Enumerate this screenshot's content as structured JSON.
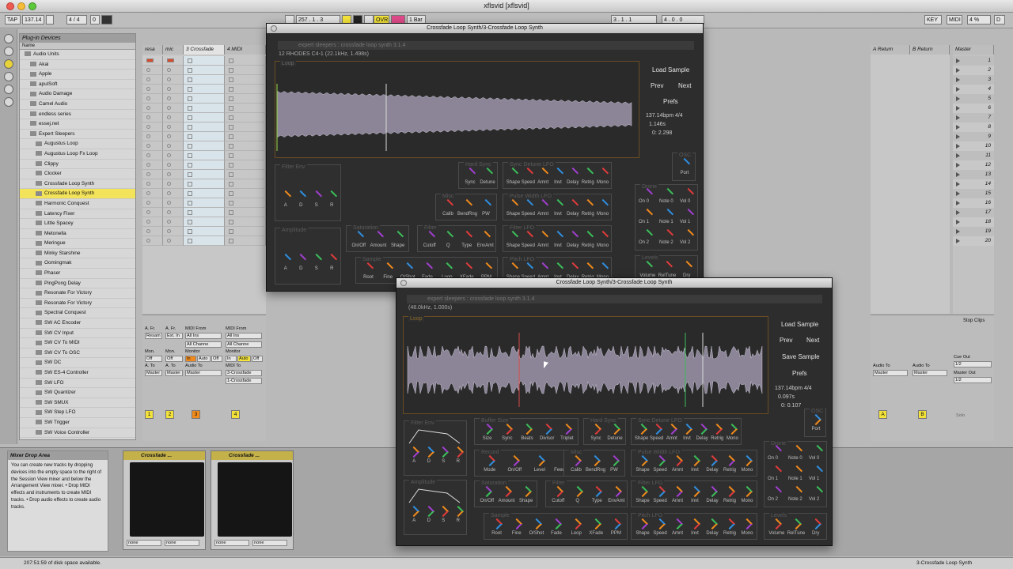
{
  "window": {
    "title": "xflsvid  [xflsvid]"
  },
  "toolbar": {
    "tap": "TAP",
    "tempo": "137.14",
    "sig": "4 / 4",
    "zero": "0",
    "position": "257 . 1 . 3",
    "ovr": "OVR",
    "quant": "1 Bar",
    "loop_start": "3 . 1 . 1",
    "loop_len": "4 . 0 . 0",
    "key": "KEY",
    "midi": "MIDI",
    "cpu": "4 %",
    "d": "D"
  },
  "browser": {
    "header": "Plug-in Devices",
    "column": "Name",
    "items": [
      "Audio Units",
      "Akai",
      "Apple",
      "apulSoft",
      "Audio Damage",
      "Camel Audio",
      "endless series",
      "essej.net",
      "Expert Sleepers",
      "Augustus Loop",
      "Augustus Loop Fx Loop",
      "Clippy",
      "Clocker",
      "Crossfade Loop Synth",
      "Crossfade Loop Synth",
      "Harmonic Conquest",
      "Latency Fixer",
      "Little Spacey",
      "Metonella",
      "Meringue",
      "Minky Starshine",
      "Oomingmak",
      "Phaser",
      "PingPong Delay",
      "Resonate For Victory",
      "Resonate For Victory",
      "Spectral Conquest",
      "SW AC Encoder",
      "SW CV Input",
      "SW CV To MIDI",
      "SW CV To OSC",
      "SW DC",
      "SW ES-4 Controller",
      "SW LFO",
      "SW Quantizer",
      "SW SMUX",
      "SW Step LFO",
      "SW Trigger",
      "SW Voice Controller"
    ]
  },
  "tracks": {
    "t1": "resa",
    "t2": "mic",
    "t3": "3 Crossfade",
    "t4": "4 MIDI",
    "a_return": "A Return",
    "b_return": "B Return",
    "master": "Master"
  },
  "scenes": [
    "1",
    "2",
    "3",
    "4",
    "5",
    "6",
    "7",
    "8",
    "9",
    "10",
    "11",
    "12",
    "13",
    "14",
    "15",
    "16",
    "17",
    "18",
    "19",
    "20"
  ],
  "mixer": {
    "afr": "A. Fr.",
    "resam": "Resam",
    "ext_in": "Ext. In",
    "midi_from": "MIDI From",
    "all_ins": "All Ins",
    "all_channels": "All Channe",
    "mon": "Mon.",
    "monitor": "Monitor",
    "in": "In",
    "auto": "Auto",
    "off": "Off",
    "ato": "A. To",
    "master": "Master",
    "audio_to": "Audio To",
    "midi_to": "MIDI To",
    "dest_synth": "3-Crossfade",
    "dest_synth2": "1-Crossfade",
    "n1": "1",
    "n2": "2",
    "n3": "3",
    "n4": "4",
    "cue_out": "Cue Out",
    "cue_val": "1/2",
    "master_out": "Master Out",
    "master_val": "1/2",
    "stop_clips": "Stop Clips",
    "a": "A",
    "b": "B",
    "solo": "Solo"
  },
  "info_view": {
    "title": "Mixer Drop Area",
    "text": "You can create new tracks by dropping devices into the empty space to the right of the Session View mixer and below the Arrangement View mixer.  • Drop MIDI effects and instruments to create MIDI tracks.  • Drop audio effects to create audio tracks."
  },
  "devices": {
    "d1": "Crossfade ...",
    "d2": "Crossfade ...",
    "none": "none"
  },
  "status": {
    "left": "207:51:59 of disk space available.",
    "right": "3-Crossfade Loop Synth"
  },
  "plugin_back": {
    "title": "Crossfade Loop Synth/3-Crossfade Loop Synth",
    "brand": "expert sleepers : crossfade loop synth 3.1.4",
    "sample": "12 RHODES C4-1   (22.1kHz, 1.498s)",
    "loop": "Loop",
    "load": "Load Sample",
    "prev": "Prev",
    "next": "Next",
    "prefs": "Prefs",
    "bpm": "137.14bpm    4/4",
    "len": "1.146s",
    "pos": "0: 2.298"
  },
  "plugin_front": {
    "title": "Crossfade Loop Synth/3-Crossfade Loop Synth",
    "brand": "expert sleepers : crossfade loop synth 3.1.4",
    "sample": "(48.0kHz, 1.000s)",
    "loop": "Loop",
    "load": "Load Sample",
    "prev": "Prev",
    "next": "Next",
    "save": "Save Sample",
    "prefs": "Prefs",
    "bpm": "137.14bpm    4/4",
    "len": "0.097s",
    "pos": "0: 0.107",
    "panels": {
      "filter_env": "Filter Env",
      "amplitude": "Amplitude",
      "buffer_size": "Buffer Size",
      "hard_sync": "Hard Sync",
      "sync_detune_lfo": "Sync Detune LFO",
      "record": "Record",
      "misc": "Misc",
      "pulse_width_lfo": "Pulse Width LFO",
      "saturation": "Saturation",
      "filter": "Filter",
      "filter_lfo": "Filter LFO",
      "sample": "Sample",
      "pitch_lfo": "Pitch LFO",
      "osc": "OSC",
      "drone": "Drone",
      "levels": "Levels"
    },
    "labels": {
      "adsr": [
        "A",
        "D",
        "S",
        "R"
      ],
      "buffer": [
        "Size",
        "Sync",
        "Beats",
        "Divisor",
        "Triplet"
      ],
      "hardsync": [
        "Sync",
        "Detune"
      ],
      "lfo": [
        "Shape",
        "Speed",
        "Amnt",
        "Invt",
        "Delay",
        "Retrig",
        "Mono"
      ],
      "record": [
        "Mode",
        "On/Off",
        "Level",
        "Feedback"
      ],
      "misc": [
        "Calib",
        "BendRng",
        "PW"
      ],
      "saturation": [
        "On/Off",
        "Amount",
        "Shape"
      ],
      "filter": [
        "Cutoff",
        "Q",
        "Type",
        "EnvAmt"
      ],
      "sample": [
        "Root",
        "Fine",
        "O/Shot",
        "Fade",
        "Loop",
        "XFade",
        "PPM"
      ],
      "drone": [
        "On 0",
        "Note 0",
        "Vol 0",
        "On 1",
        "Note 1",
        "Vol 1",
        "On 2",
        "Note 2",
        "Vol 2"
      ],
      "levels": [
        "Volume",
        "RelTune",
        "Dry"
      ],
      "osc": "Port"
    }
  },
  "colors": {
    "accent": "#f1e13a",
    "plugin_bg": "#2d2d2d",
    "knob_orange": "#f08a1c",
    "knob_blue": "#2f8fe0",
    "knob_purple": "#a23fd0",
    "knob_red": "#e23b3b",
    "knob_green": "#3bbf5a"
  }
}
